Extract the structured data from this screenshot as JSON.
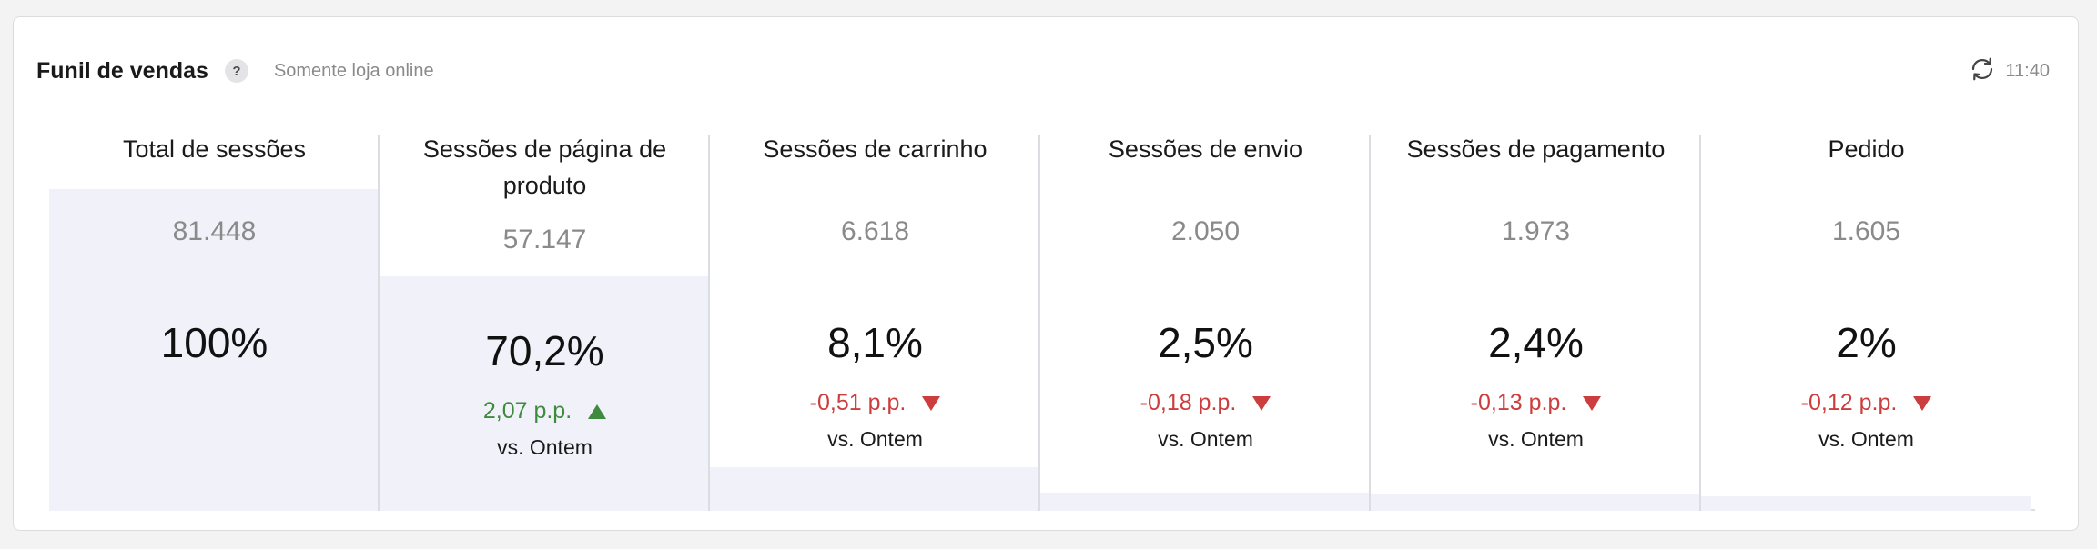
{
  "header": {
    "title": "Funil de vendas",
    "help_label": "?",
    "subtitle": "Somente loja online",
    "refresh_time": "11:40"
  },
  "colors": {
    "positive": "#3f8a3f",
    "negative": "#cc3d3d",
    "bar_fill": "#f1f2f9"
  },
  "funnel": {
    "stages": [
      {
        "title": "Total de sessões",
        "count": "81.448",
        "percent": "100%",
        "bar_fill": 1.0
      },
      {
        "title": "Sessões de página de produto",
        "count": "57.147",
        "percent": "70,2%",
        "delta": "2,07 p.p.",
        "delta_direction": "up",
        "comparison": "vs. Ontem",
        "bar_fill": 0.702
      },
      {
        "title": "Sessões de carrinho",
        "count": "6.618",
        "percent": "8,1%",
        "delta": "-0,51 p.p.",
        "delta_direction": "down",
        "comparison": "vs. Ontem",
        "bar_fill": 0.081
      },
      {
        "title": "Sessões de envio",
        "count": "2.050",
        "percent": "2,5%",
        "delta": "-0,18 p.p.",
        "delta_direction": "down",
        "comparison": "vs. Ontem",
        "bar_fill": 0.025
      },
      {
        "title": "Sessões de pagamento",
        "count": "1.973",
        "percent": "2,4%",
        "delta": "-0,13 p.p.",
        "delta_direction": "down",
        "comparison": "vs. Ontem",
        "bar_fill": 0.024
      },
      {
        "title": "Pedido",
        "count": "1.605",
        "percent": "2%",
        "delta": "-0,12 p.p.",
        "delta_direction": "down",
        "comparison": "vs. Ontem",
        "bar_fill": 0.02
      }
    ]
  }
}
